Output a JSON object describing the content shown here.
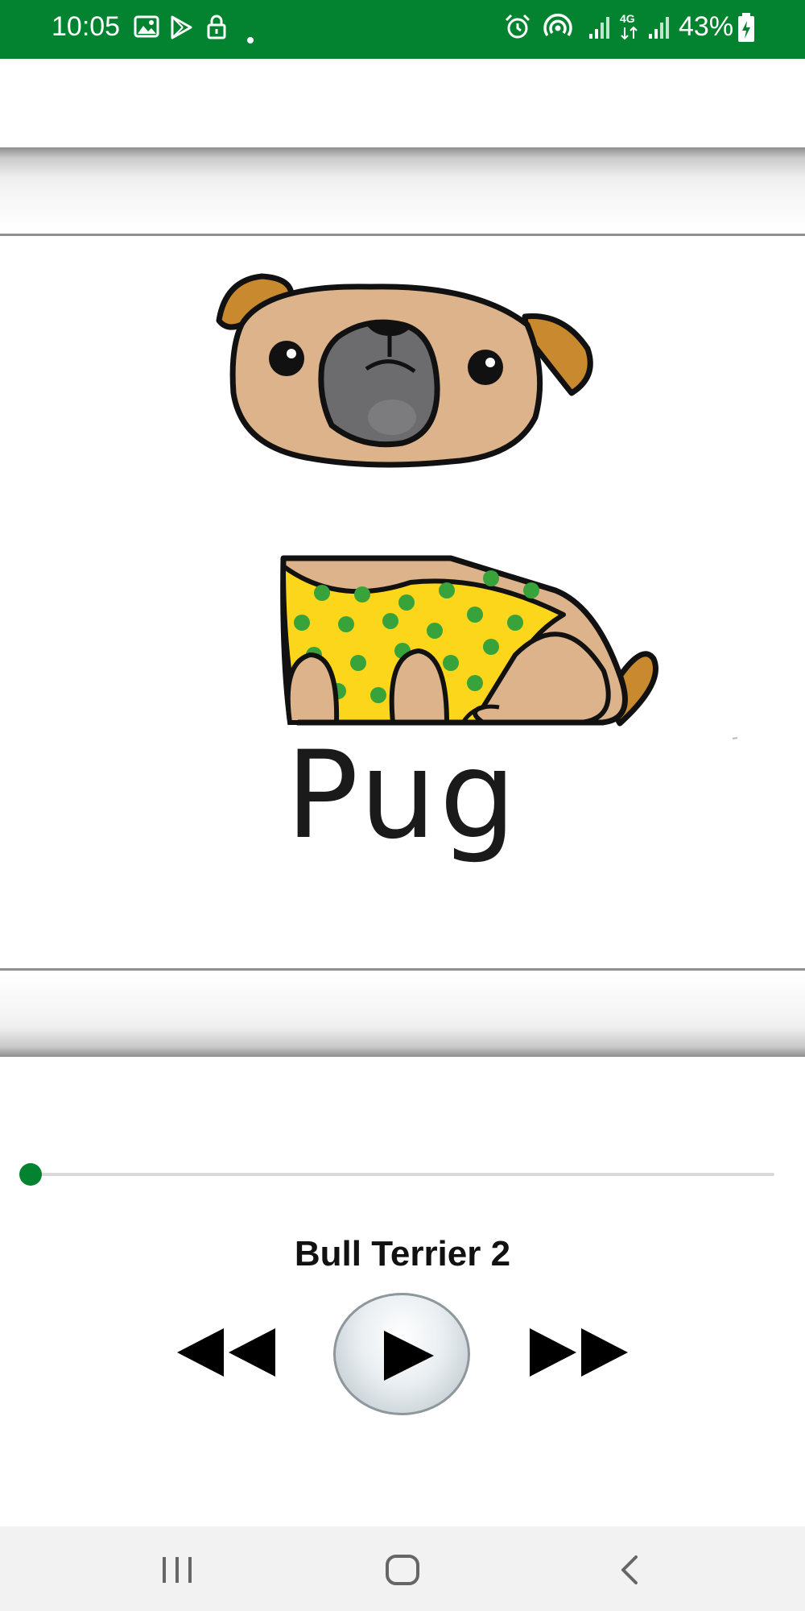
{
  "status_bar": {
    "time": "10:05",
    "battery": "43%",
    "background": "#03832f",
    "left_icons": [
      "gallery-icon",
      "play-store-icon",
      "lock-icon",
      "dot-icon"
    ],
    "right_icons": [
      "alarm-icon",
      "hotspot-icon",
      "signal-icon",
      "4g-icon",
      "signal-icon",
      "battery-charging-icon"
    ]
  },
  "card": {
    "caption": "Pug",
    "illustration": "pug-in-yellow-sweater"
  },
  "player": {
    "track_title": "Bull Terrier 2",
    "progress_fraction": 0.0,
    "accent": "#03832f",
    "controls": [
      "rewind-icon",
      "play-icon",
      "fast-forward-icon"
    ]
  },
  "nav_bar": {
    "buttons": [
      "recent-apps-icon",
      "home-icon",
      "back-icon"
    ]
  }
}
